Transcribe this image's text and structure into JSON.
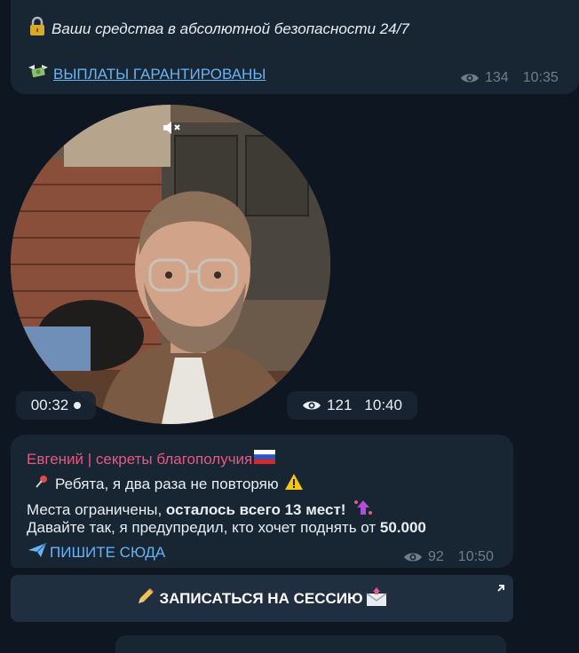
{
  "post1": {
    "line1_text": "Ваши средства в абсолютной безопасности 24/7",
    "line1_icon": "lock-icon",
    "line2_link": "ВЫПЛАТЫ ГАРАНТИРОВАНЫ",
    "line2_icon": "money-wings-icon",
    "views": "134",
    "time": "10:35"
  },
  "video_note": {
    "duration": "00:32",
    "views": "121",
    "time": "10:40",
    "muted": true
  },
  "post2": {
    "author": "Евгений | секреты благополучия",
    "line1": "Ребята, я два раза не повторяю",
    "line2_prefix": "Места ограничены, ",
    "line2_bold": "осталось всего 13 мест!",
    "line3_prefix": "Давайте так, я предупредил, кто хочет поднять от ",
    "line3_bold": "50.000",
    "link": "ПИШИТЕ СЮДА",
    "views": "92",
    "time": "10:50"
  },
  "button": {
    "label": "ЗАПИСАТЬСЯ НА СЕССИЮ"
  },
  "colors": {
    "background": "#0e1621",
    "bubble": "#182533",
    "link": "#6ab3f3",
    "author": "#e75883",
    "meta": "#6d7f8f"
  }
}
